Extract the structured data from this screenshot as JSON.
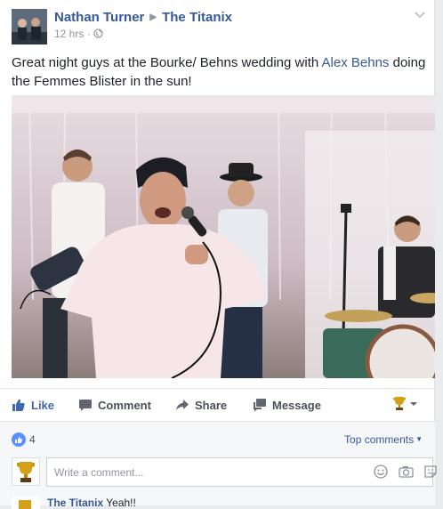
{
  "post": {
    "author": "Nathan Turner",
    "target": "The Titanix",
    "time": "12 hrs",
    "separator": "·",
    "text_before": "Great night guys at the Bourke/ Behns wedding with ",
    "mention": "Alex Behns",
    "text_after": " doing the Femmes Blister in the sun!"
  },
  "actions": {
    "like": "Like",
    "comment": "Comment",
    "share": "Share",
    "message": "Message"
  },
  "stats": {
    "reactions_count": "4",
    "sort_label": "Top comments"
  },
  "composer": {
    "placeholder": "Write a comment..."
  },
  "comment": {
    "author": "The Titanix",
    "text": "Yeah!!"
  },
  "colors": {
    "link": "#365899",
    "like_blue": "#4267b2",
    "badge_blue": "#5890ff",
    "meta_gray": "#90949c"
  },
  "icons": [
    "globe-icon",
    "chevron-down-icon",
    "thumbs-up-icon",
    "comment-icon",
    "share-arrow-icon",
    "message-icon",
    "trophy-icon",
    "emoji-icon",
    "camera-icon",
    "sticker-icon"
  ]
}
